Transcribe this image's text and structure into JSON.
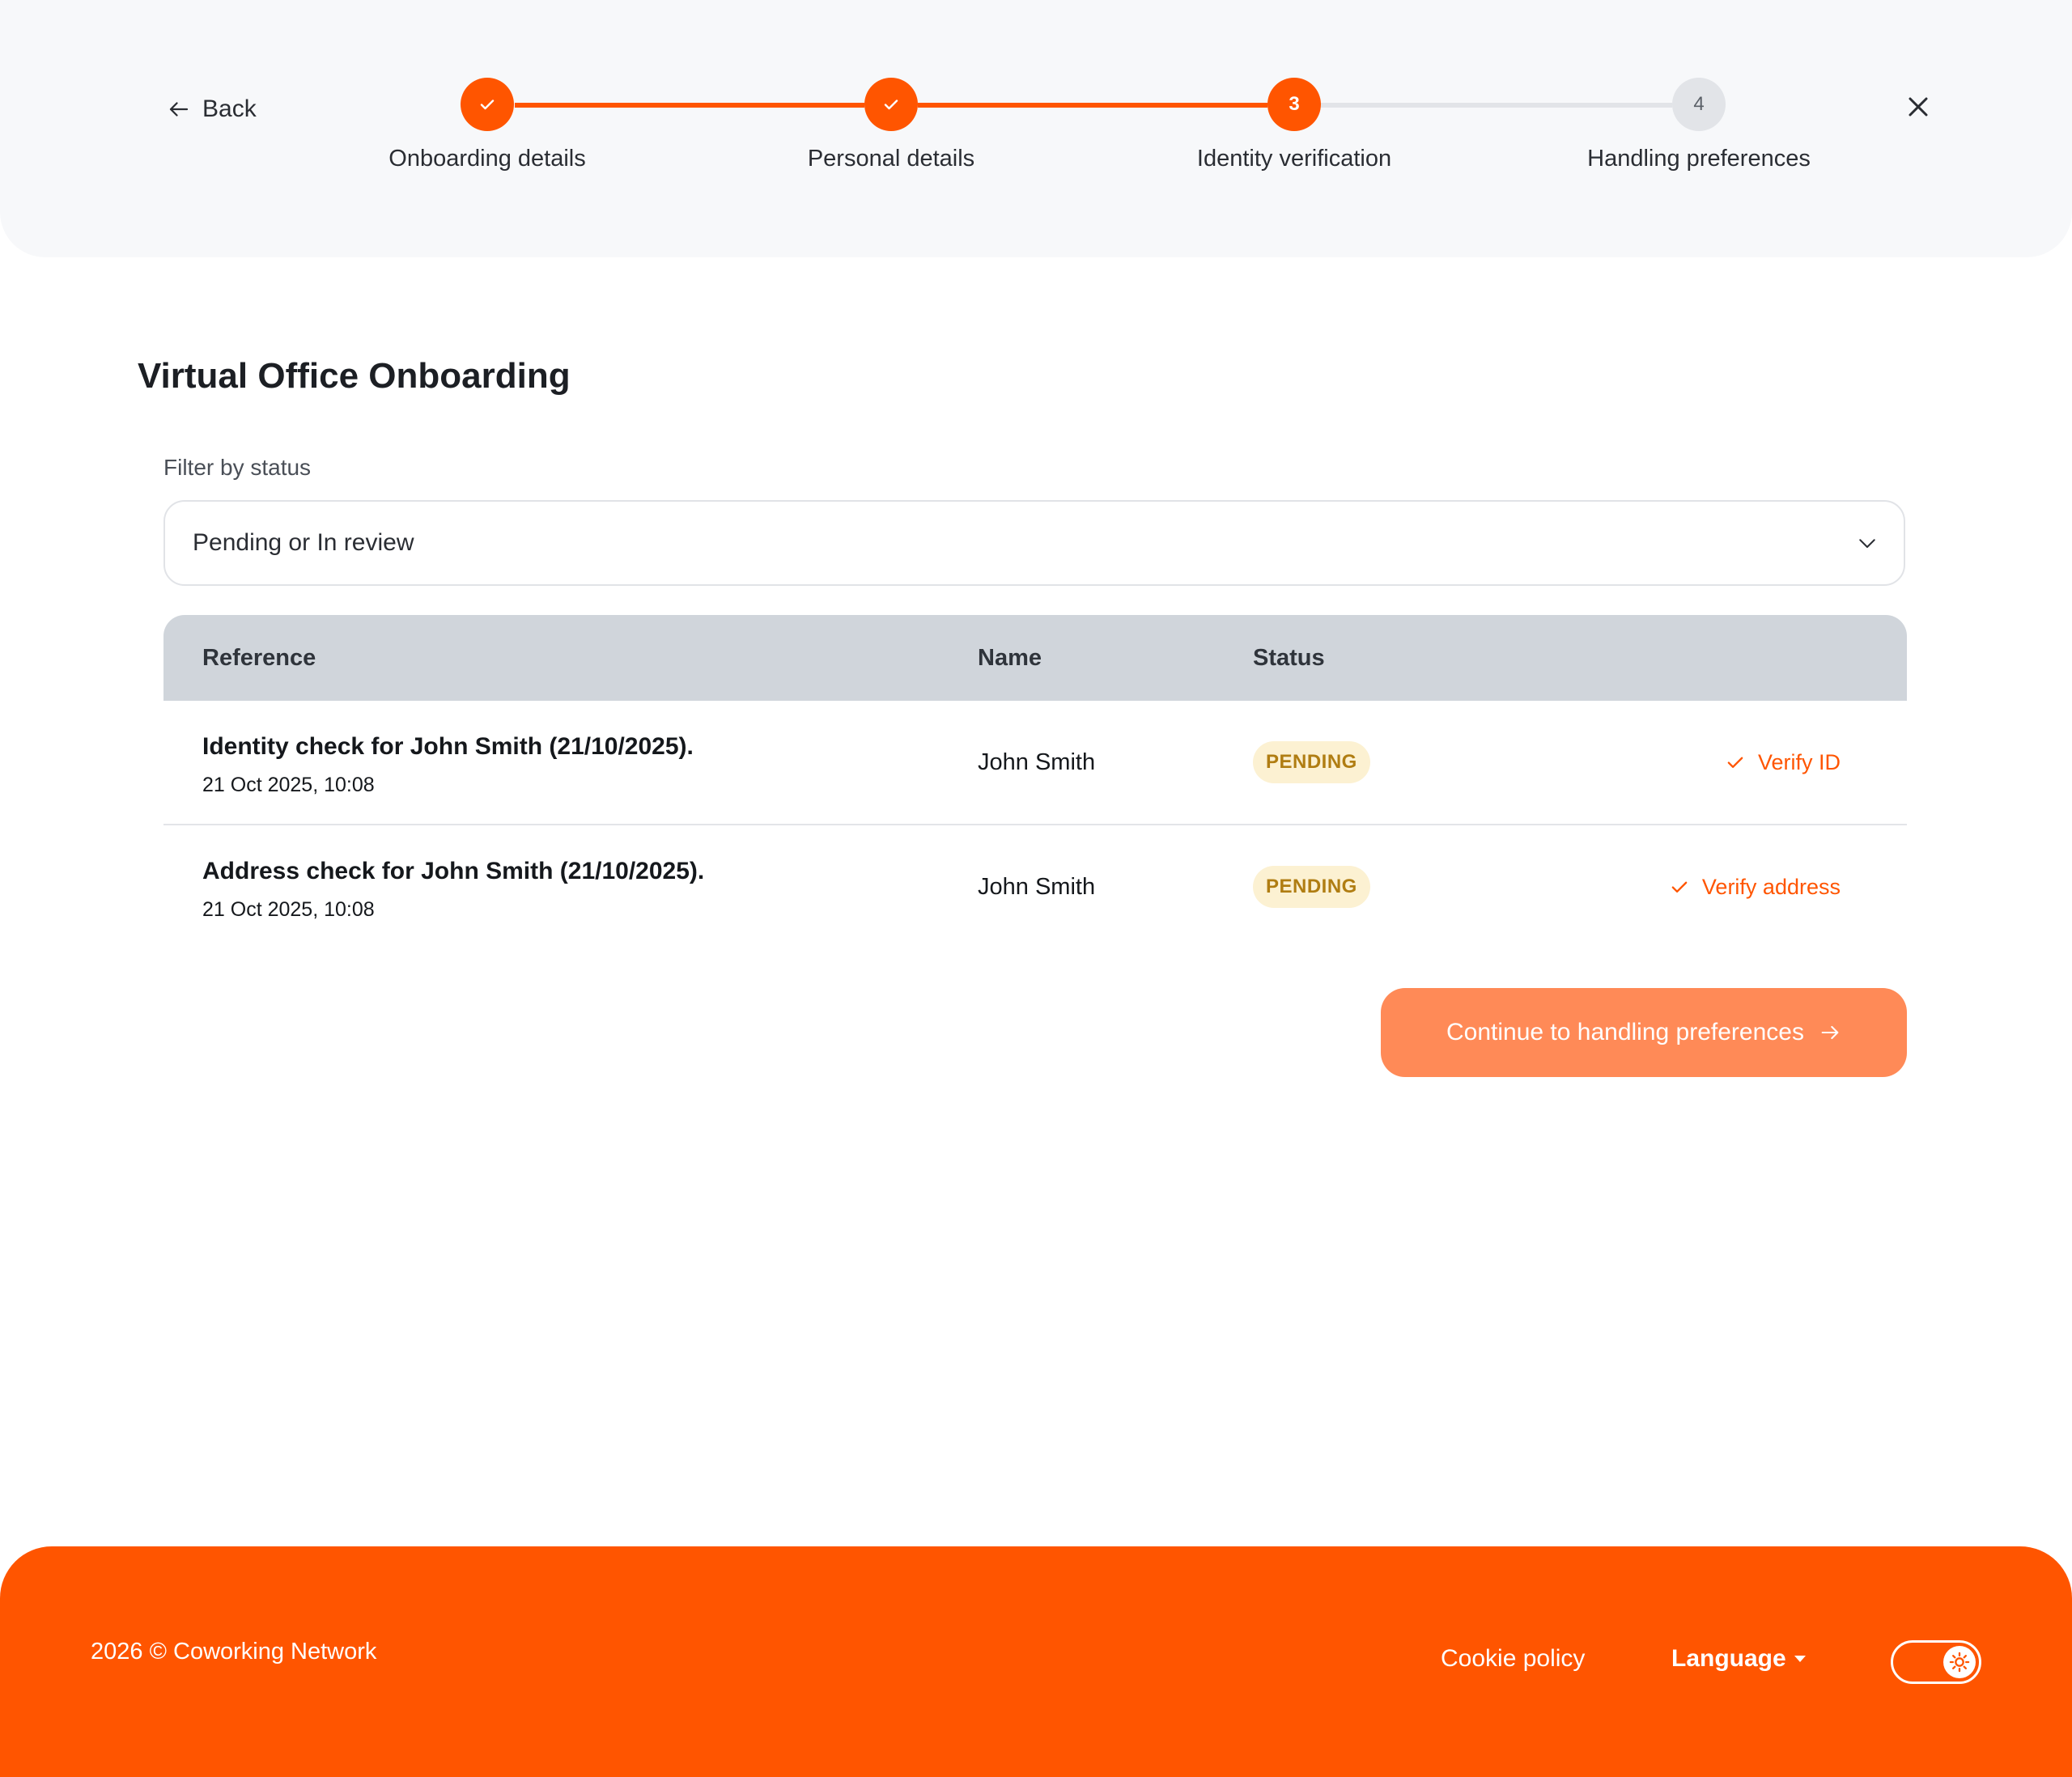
{
  "header": {
    "back_label": "Back",
    "steps": [
      {
        "number": "1",
        "label": "Onboarding details",
        "state": "done"
      },
      {
        "number": "2",
        "label": "Personal details",
        "state": "done"
      },
      {
        "number": "3",
        "label": "Identity verification",
        "state": "active"
      },
      {
        "number": "4",
        "label": "Handling preferences",
        "state": "todo"
      }
    ]
  },
  "main": {
    "title": "Virtual Office Onboarding",
    "filter": {
      "label": "Filter by status",
      "value": "Pending or In review"
    },
    "table": {
      "columns": [
        "Reference",
        "Name",
        "Status"
      ],
      "rows": [
        {
          "reference": "Identity check for John Smith (21/10/2025).",
          "date": "21 Oct 2025, 10:08",
          "name": "John Smith",
          "status": "PENDING",
          "action": "Verify ID"
        },
        {
          "reference": "Address check for John Smith (21/10/2025).",
          "date": "21 Oct 2025, 10:08",
          "name": "John Smith",
          "status": "PENDING",
          "action": "Verify address"
        }
      ]
    },
    "continue_label": "Continue to handling preferences"
  },
  "footer": {
    "copyright": "2026 © Coworking Network",
    "cookie_policy": "Cookie policy",
    "language": "Language",
    "theme_toggle_icon": "sun-icon"
  },
  "colors": {
    "accent": "#ff5500",
    "button_disabled": "#ff8a57",
    "badge_bg": "#fcf1d2",
    "badge_text": "#b07d12",
    "header_bg": "#f7f8fa",
    "table_header_bg": "#d0d5db"
  }
}
